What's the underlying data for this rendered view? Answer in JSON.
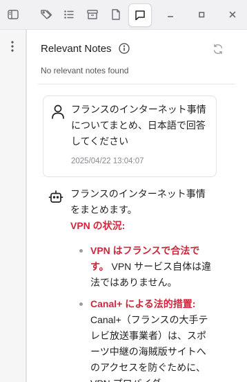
{
  "toolbar": {
    "buttons": [
      {
        "name": "sidebar-toggle-icon"
      },
      {
        "name": "tags-icon"
      },
      {
        "name": "list-icon"
      },
      {
        "name": "archive-icon"
      },
      {
        "name": "file-icon"
      },
      {
        "name": "chat-bubble-icon",
        "active": true
      }
    ],
    "window_controls": [
      "minimize-icon",
      "maximize-icon",
      "close-icon"
    ]
  },
  "relevant_notes": {
    "title": "Relevant Notes",
    "empty_text": "No relevant notes found"
  },
  "conversation": {
    "user_message": {
      "text": "フランスのインターネット事情についてまとめ、日本語で回答してください",
      "timestamp": "2025/04/22 13:04:07"
    },
    "assistant_message": {
      "intro": "フランスのインターネット事情をまとめます。",
      "section_heading": "VPN の状況:",
      "bullets": [
        {
          "heading": "VPN はフランスで合法です。",
          "text": "VPN サービス自体は違法ではありません。"
        },
        {
          "heading": "Canal+ による法的措置:",
          "text": "Canal+（フランスの大手テレビ放送事業者）は、スポーツ中継の海賊版サイトへのアクセスを防ぐために、VPN プロバイダ"
        }
      ]
    }
  },
  "colors": {
    "accent_red": "#d0253b",
    "toolbar_bg": "#f1f1f4",
    "panel_bg": "#ffffff"
  }
}
